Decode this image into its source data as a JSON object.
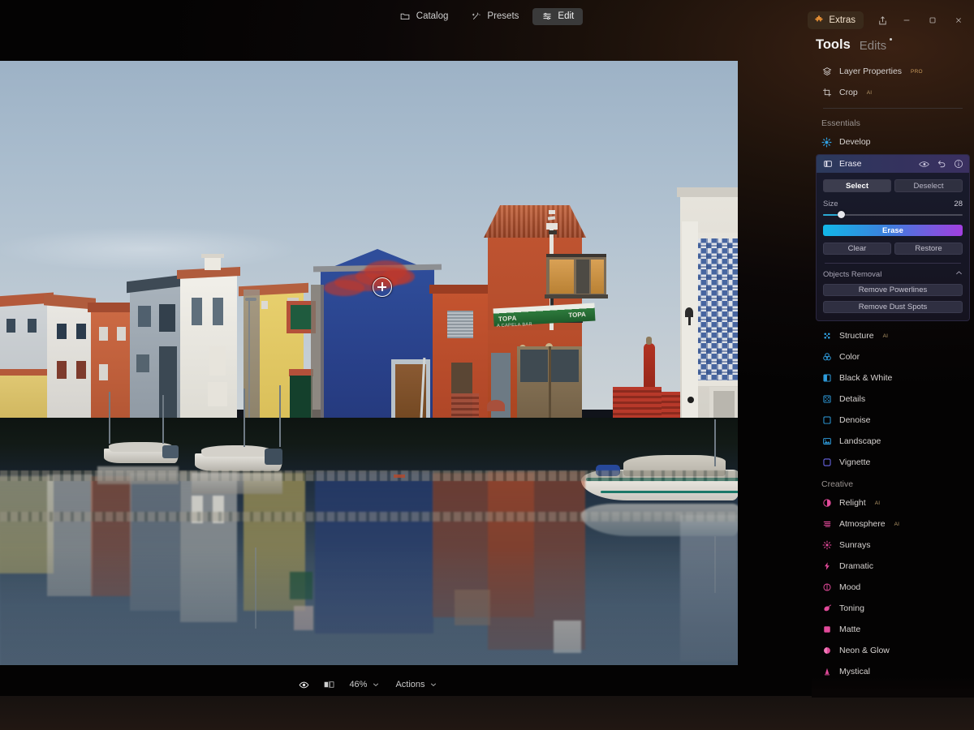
{
  "window": {
    "extras_label": "Extras",
    "extras_icon": "puzzle-piece-icon",
    "share_icon": "share-icon",
    "minimize_icon": "minimize-icon",
    "maximize_icon": "maximize-icon",
    "close_icon": "close-icon",
    "accent_orange": "#c98a3c"
  },
  "topnav": {
    "tabs": [
      {
        "label": "Catalog",
        "icon": "folder-icon",
        "active": false
      },
      {
        "label": "Presets",
        "icon": "sparkle-icon",
        "active": false
      },
      {
        "label": "Edit",
        "icon": "sliders-icon",
        "active": true
      }
    ]
  },
  "canvasbar": {
    "compare_icon": "eye-icon",
    "split_icon": "before-after-icon",
    "zoom_label": "46%",
    "zoom_caret": "chevron-down-icon",
    "actions_label": "Actions",
    "actions_caret": "chevron-down-icon"
  },
  "panel": {
    "title": "Tools",
    "secondary_title": "Edits",
    "top_tools": [
      {
        "label": "Layer Properties",
        "badge": "PRO",
        "icon": "layers-icon"
      },
      {
        "label": "Crop",
        "badge": "AI",
        "icon": "crop-icon"
      }
    ],
    "sections": [
      {
        "name": "Essentials",
        "items": [
          {
            "label": "Develop",
            "badge": "",
            "icon": "develop-icon",
            "color": "#2f9fe0"
          },
          {
            "label": "Structure",
            "badge": "AI",
            "icon": "structure-icon",
            "color": "#2f9fe0"
          },
          {
            "label": "Color",
            "badge": "",
            "icon": "color-icon",
            "color": "#2f9fe0"
          },
          {
            "label": "Black & White",
            "badge": "",
            "icon": "blackwhite-icon",
            "color": "#2f9fe0"
          },
          {
            "label": "Details",
            "badge": "",
            "icon": "details-icon",
            "color": "#2f9fe0"
          },
          {
            "label": "Denoise",
            "badge": "",
            "icon": "denoise-icon",
            "color": "#2f9fe0"
          },
          {
            "label": "Landscape",
            "badge": "",
            "icon": "landscape-icon",
            "color": "#2f9fe0"
          },
          {
            "label": "Vignette",
            "badge": "",
            "icon": "vignette-icon",
            "color": "#6a67e8"
          }
        ]
      },
      {
        "name": "Creative",
        "items": [
          {
            "label": "Relight",
            "badge": "AI",
            "icon": "relight-icon",
            "color": "#e24a9a"
          },
          {
            "label": "Atmosphere",
            "badge": "AI",
            "icon": "atmosphere-icon",
            "color": "#e24a9a"
          },
          {
            "label": "Sunrays",
            "badge": "",
            "icon": "sunrays-icon",
            "color": "#e24a9a"
          },
          {
            "label": "Dramatic",
            "badge": "",
            "icon": "dramatic-icon",
            "color": "#e24a9a"
          },
          {
            "label": "Mood",
            "badge": "",
            "icon": "mood-icon",
            "color": "#e24a9a"
          },
          {
            "label": "Toning",
            "badge": "",
            "icon": "toning-icon",
            "color": "#e24a9a"
          },
          {
            "label": "Matte",
            "badge": "",
            "icon": "matte-icon",
            "color": "#e24a9a"
          },
          {
            "label": "Neon & Glow",
            "badge": "",
            "icon": "neonglow-icon",
            "color": "#e24a9a"
          },
          {
            "label": "Mystical",
            "badge": "",
            "icon": "mystical-icon",
            "color": "#e24a9a"
          }
        ]
      }
    ]
  },
  "erase_tool": {
    "title": "Erase",
    "icon": "erase-icon",
    "header_actions": [
      {
        "icon": "eye-icon",
        "name": "toggle-visibility"
      },
      {
        "icon": "undo-icon",
        "name": "reset-tool"
      },
      {
        "icon": "info-icon",
        "name": "tool-info"
      }
    ],
    "select_label": "Select",
    "deselect_label": "Deselect",
    "active_mode": "Select",
    "size_label": "Size",
    "size_value": "28",
    "size_percent": 13,
    "erase_label": "Erase",
    "clear_label": "Clear",
    "restore_label": "Restore",
    "objects_removal_label": "Objects Removal",
    "objects_removal_expanded": true,
    "remove_powerlines_label": "Remove Powerlines",
    "remove_dust_spots_label": "Remove Dust Spots",
    "gradient_start": "#12b7e8",
    "gradient_end": "#a23fe0"
  },
  "photo": {
    "description": "Canal waterfront with colorful houses and reflections, moored boats",
    "signage": [
      {
        "text": "A CAPELA BAR"
      },
      {
        "text": "TOPA"
      }
    ],
    "mask_color": "#c0392b",
    "brush_cursor": "brush-crosshair-cursor"
  }
}
